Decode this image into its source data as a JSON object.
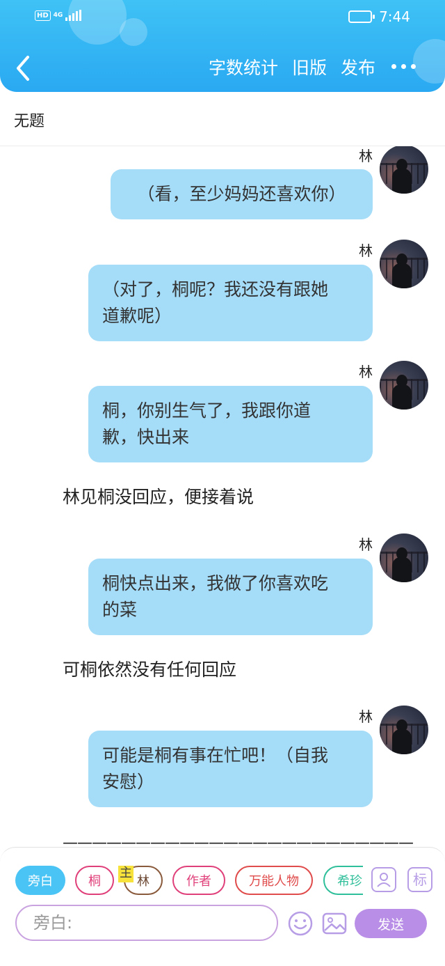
{
  "status_bar": {
    "left_badge": "HD",
    "network": "4G",
    "time": "7:44"
  },
  "header": {
    "actions": [
      "字数统计",
      "旧版",
      "发布"
    ],
    "icons": {
      "back": "chevron-left-icon",
      "more": "more-dots-icon"
    }
  },
  "document": {
    "title": "无题"
  },
  "chat": {
    "messages": [
      {
        "type": "character",
        "speaker": "林",
        "text_lines": [
          "（看，至少妈妈还喜欢你）"
        ]
      },
      {
        "type": "character",
        "speaker": "林",
        "text_lines": [
          "（对了，桐呢？我还没有跟她",
          "道歉呢）"
        ]
      },
      {
        "type": "character",
        "speaker": "林",
        "text_lines": [
          "桐，你别生气了，我跟你道",
          "歉，快出来"
        ]
      },
      {
        "type": "narration",
        "text": "林见桐没回应，便接着说"
      },
      {
        "type": "character",
        "speaker": "林",
        "text_lines": [
          "桐快点出来，我做了你喜欢吃",
          "的菜"
        ]
      },
      {
        "type": "narration",
        "text": "可桐依然没有任何回应"
      },
      {
        "type": "character",
        "speaker": "林",
        "text_lines": [
          "可能是桐有事在忙吧！（自我",
          "安慰）"
        ]
      },
      {
        "type": "narration",
        "text": "————————————————————————"
      }
    ]
  },
  "composer": {
    "roles": [
      {
        "label": "旁白",
        "active": true
      },
      {
        "label": "桐",
        "active": false
      },
      {
        "label": "林",
        "active": false,
        "tag": "主"
      },
      {
        "label": "作者",
        "active": false
      },
      {
        "label": "万能人物",
        "active": false
      },
      {
        "label": "希珍",
        "active": false
      }
    ],
    "side_buttons": [
      {
        "icon": "person-card-icon",
        "label": ""
      },
      {
        "icon": "tag-icon",
        "label": "标"
      }
    ],
    "input_placeholder": "旁白:",
    "emoji_icon": "emoji-icon",
    "image_icon": "image-icon",
    "send_label": "发送"
  },
  "colors": {
    "header": "#2aa9f2",
    "bubble": "#a5dcf8",
    "active_chip": "#49c4f5",
    "send": "#b98ee6",
    "chip_borders": [
      "#e0407a",
      "#8a5a3c",
      "#e0407a",
      "#e04b4b",
      "#2fbf9a"
    ]
  }
}
